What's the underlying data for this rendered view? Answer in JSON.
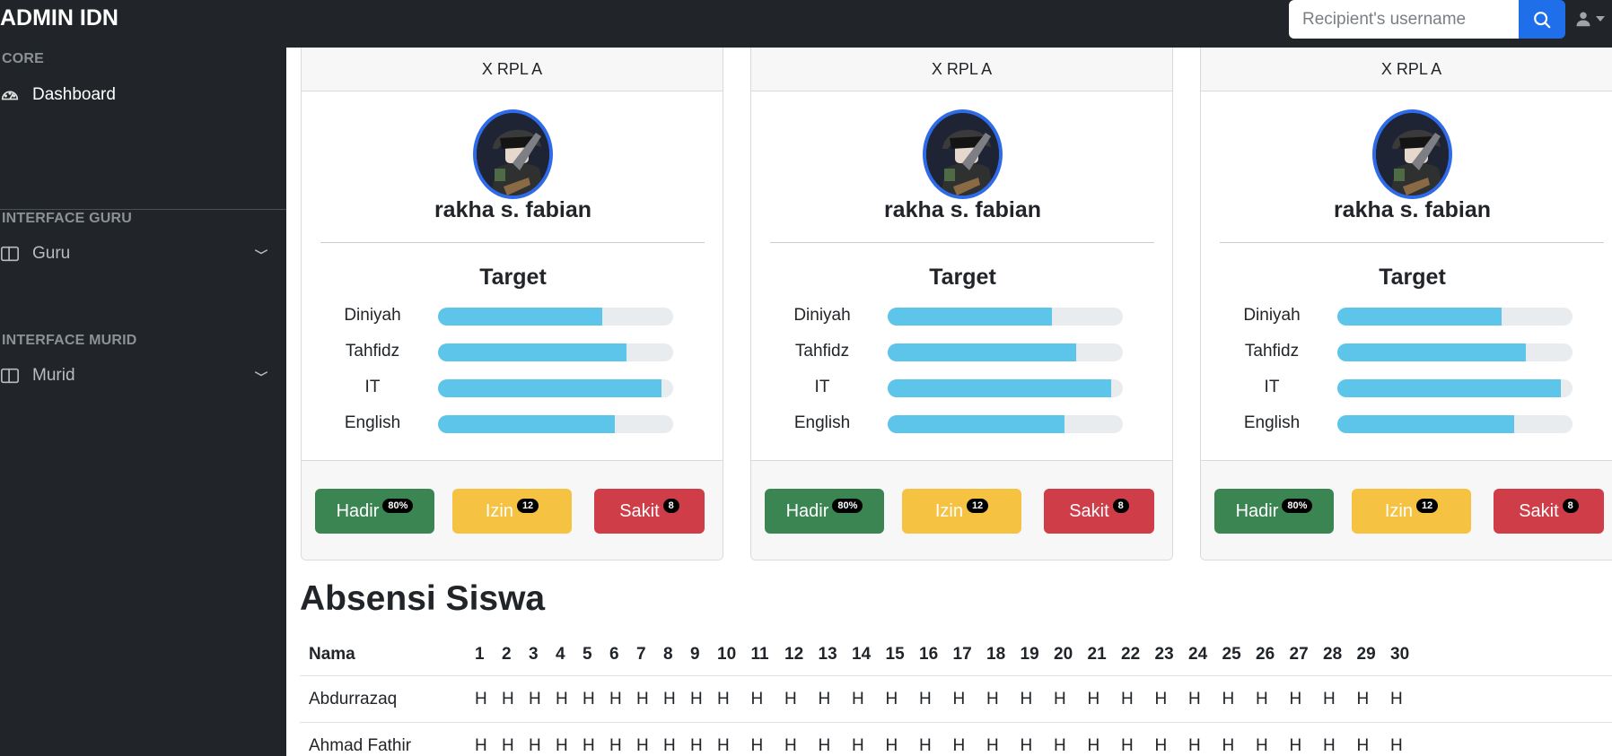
{
  "brand": "ADMIN IDN",
  "search": {
    "placeholder": "Recipient's username"
  },
  "user_menu": {
    "icon": "user-icon",
    "caret": "caret-down-icon"
  },
  "sidebar": {
    "sections": [
      {
        "heading": "CORE",
        "items": [
          {
            "label": "Dashboard",
            "icon": "speedometer-icon"
          }
        ]
      },
      {
        "heading": "INTERFACE GURU",
        "items": [
          {
            "label": "Guru",
            "icon": "columns-icon",
            "expandable": true
          }
        ]
      },
      {
        "heading": "INTERFACE MURID",
        "items": [
          {
            "label": "Murid",
            "icon": "columns-icon",
            "expandable": true
          }
        ]
      }
    ]
  },
  "cards": [
    {
      "class_name": "X RPL A",
      "name": "rakha s. fabian",
      "target_title": "Target",
      "progress": [
        {
          "label": "Diniyah",
          "percent": 70
        },
        {
          "label": "Tahfidz",
          "percent": 80
        },
        {
          "label": "IT",
          "percent": 95
        },
        {
          "label": "English",
          "percent": 75
        }
      ],
      "hadir": {
        "label": "Hadir",
        "badge": "80%"
      },
      "izin": {
        "label": "Izin",
        "badge": "12"
      },
      "sakit": {
        "label": "Sakit",
        "badge": "8"
      }
    },
    {
      "class_name": "X RPL A",
      "name": "rakha s. fabian",
      "target_title": "Target",
      "progress": [
        {
          "label": "Diniyah",
          "percent": 70
        },
        {
          "label": "Tahfidz",
          "percent": 80
        },
        {
          "label": "IT",
          "percent": 95
        },
        {
          "label": "English",
          "percent": 75
        }
      ],
      "hadir": {
        "label": "Hadir",
        "badge": "80%"
      },
      "izin": {
        "label": "Izin",
        "badge": "12"
      },
      "sakit": {
        "label": "Sakit",
        "badge": "8"
      }
    },
    {
      "class_name": "X RPL A",
      "name": "rakha s. fabian",
      "target_title": "Target",
      "progress": [
        {
          "label": "Diniyah",
          "percent": 70
        },
        {
          "label": "Tahfidz",
          "percent": 80
        },
        {
          "label": "IT",
          "percent": 95
        },
        {
          "label": "English",
          "percent": 75
        }
      ],
      "hadir": {
        "label": "Hadir",
        "badge": "80%"
      },
      "izin": {
        "label": "Izin",
        "badge": "12"
      },
      "sakit": {
        "label": "Sakit",
        "badge": "8"
      }
    }
  ],
  "attendance": {
    "title": "Absensi Siswa",
    "name_header": "Nama",
    "days": [
      "1",
      "2",
      "3",
      "4",
      "5",
      "6",
      "7",
      "8",
      "9",
      "10",
      "11",
      "12",
      "13",
      "14",
      "15",
      "16",
      "17",
      "18",
      "19",
      "20",
      "21",
      "22",
      "23",
      "24",
      "25",
      "26",
      "27",
      "28",
      "29",
      "30"
    ],
    "rows": [
      {
        "name": "Abdurrazaq",
        "values": [
          "H",
          "H",
          "H",
          "H",
          "H",
          "H",
          "H",
          "H",
          "H",
          "H",
          "H",
          "H",
          "H",
          "H",
          "H",
          "H",
          "H",
          "H",
          "H",
          "H",
          "H",
          "H",
          "H",
          "H",
          "H",
          "H",
          "H",
          "H",
          "H",
          "H"
        ]
      },
      {
        "name": "Ahmad Fathir",
        "values": [
          "H",
          "H",
          "H",
          "H",
          "H",
          "H",
          "H",
          "H",
          "H",
          "H",
          "H",
          "H",
          "H",
          "H",
          "H",
          "H",
          "H",
          "H",
          "H",
          "H",
          "H",
          "H",
          "H",
          "H",
          "H",
          "H",
          "H",
          "H",
          "H",
          "H"
        ]
      }
    ]
  },
  "colors": {
    "dark": "#212529",
    "primary": "#1f6feb",
    "progress": "#5ec5ea",
    "success": "#3b8553",
    "warning": "#f5c242",
    "danger": "#cf3d48"
  }
}
